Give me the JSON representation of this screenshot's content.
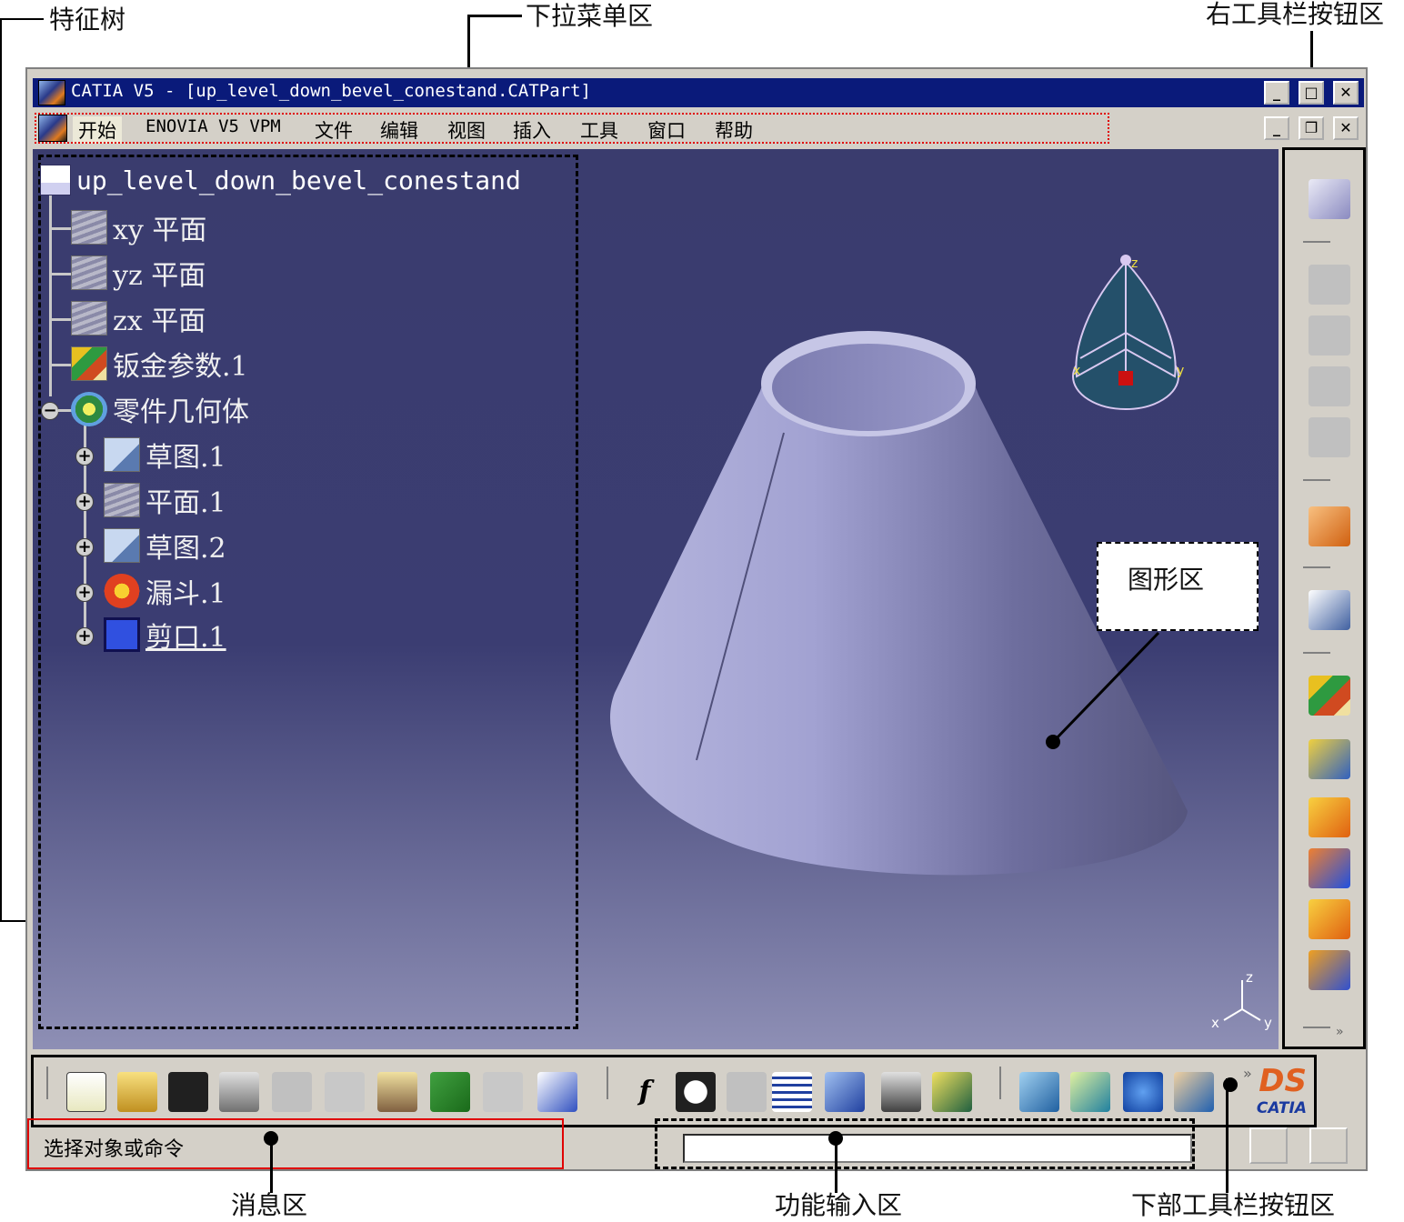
{
  "annotations": {
    "feature_tree": "特征树",
    "menu_area": "下拉菜单区",
    "right_toolbar": "右工具栏按钮区",
    "graphics_area": "图形区",
    "message_area": "消息区",
    "function_input_area": "功能输入区",
    "bottom_toolbar": "下部工具栏按钮区"
  },
  "window": {
    "title": "CATIA V5 - [up_level_down_bevel_conestand.CATPart]",
    "controls": [
      "minimize-icon",
      "maximize-icon",
      "close-icon"
    ]
  },
  "menu": {
    "items": [
      "开始",
      "ENOVIA V5 VPM",
      "文件",
      "编辑",
      "视图",
      "插入",
      "工具",
      "窗口",
      "帮助"
    ],
    "doc_controls": [
      "minimize-icon",
      "restore-icon",
      "close-icon"
    ]
  },
  "tree": {
    "root": "up_level_down_bevel_conestand",
    "items": [
      {
        "label": "xy 平面",
        "icon": "plane-icon"
      },
      {
        "label": "yz 平面",
        "icon": "plane-icon"
      },
      {
        "label": "zx 平面",
        "icon": "plane-icon"
      },
      {
        "label": "钣金参数.1",
        "icon": "sheetmetal-params-icon"
      },
      {
        "label": "零件几何体",
        "icon": "part-body-icon"
      },
      {
        "label": "草图.1",
        "icon": "sketch-icon"
      },
      {
        "label": "平面.1",
        "icon": "plane-icon"
      },
      {
        "label": "草图.2",
        "icon": "sketch-icon"
      },
      {
        "label": "漏斗.1",
        "icon": "hopper-icon"
      },
      {
        "label": "剪口.1",
        "icon": "cutout-icon"
      }
    ]
  },
  "compass": {
    "x": "x",
    "y": "y",
    "z": "z"
  },
  "axis_triad": {
    "x": "x",
    "y": "y",
    "z": "z"
  },
  "status": {
    "message": "选择对象或命令",
    "function_input_value": ""
  },
  "right_toolbar": {
    "icons": [
      "wall-icon",
      "select-icon",
      "sketch-icon",
      "sheetmetal-params-icon",
      "hopper-icon",
      "wall-extrude-icon",
      "flange-icon",
      "swept-wall-icon",
      "bend-icon",
      "more-icon"
    ]
  },
  "bottom_toolbar": {
    "icons": [
      "new-icon",
      "open-icon",
      "save-icon",
      "print-icon",
      "cut-icon",
      "copy-icon",
      "paste-icon",
      "undo-icon",
      "redo-icon",
      "whats-this-icon",
      "formula-icon",
      "knowledge-icon",
      "hide-icon",
      "table-icon",
      "tree-expand-icon",
      "lock-icon",
      "parameters-icon",
      "fly-icon",
      "fit-all-icon",
      "pan-icon",
      "rotate-icon"
    ],
    "logo": "CATIA"
  },
  "colors": {
    "title_bar": "#0a1a7a",
    "viewport_top": "#3a3c6e",
    "viewport_bottom": "#8e8fb5",
    "cone": "#9d9ccf",
    "message_border": "#e00000"
  }
}
